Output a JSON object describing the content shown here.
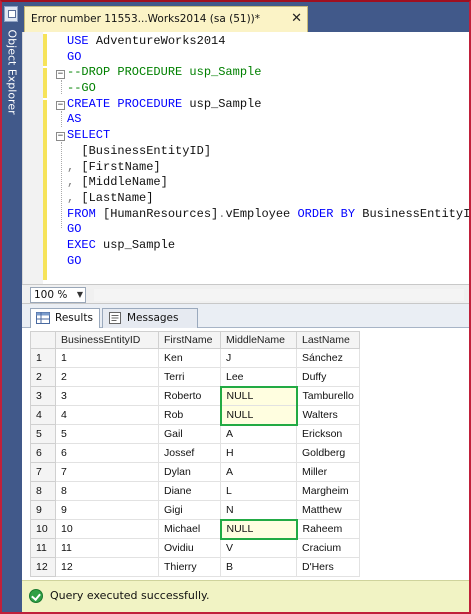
{
  "object_explorer": {
    "label": "Object Explorer"
  },
  "document_tab": {
    "title": "Error number 11553...Works2014 (sa (51))*",
    "close_glyph": "✕"
  },
  "editor": {
    "lines": [
      [
        {
          "t": "USE ",
          "c": "kw"
        },
        {
          "t": "AdventureWorks2014",
          "c": "tx"
        }
      ],
      [
        {
          "t": "GO",
          "c": "kw"
        }
      ],
      [
        {
          "t": "--DROP PROCEDURE usp_Sample",
          "c": "cm"
        }
      ],
      [
        {
          "t": "--GO",
          "c": "cm"
        }
      ],
      [
        {
          "t": "CREATE PROCEDURE ",
          "c": "kw"
        },
        {
          "t": "usp_Sample",
          "c": "tx"
        }
      ],
      [
        {
          "t": "AS",
          "c": "kw"
        }
      ],
      [
        {
          "t": "SELECT",
          "c": "kw"
        }
      ],
      [
        {
          "t": "  [BusinessEntityID]",
          "c": "tx"
        }
      ],
      [
        {
          "t": ", ",
          "c": "gy"
        },
        {
          "t": "[FirstName]",
          "c": "tx"
        }
      ],
      [
        {
          "t": ", ",
          "c": "gy"
        },
        {
          "t": "[MiddleName]",
          "c": "tx"
        }
      ],
      [
        {
          "t": ", ",
          "c": "gy"
        },
        {
          "t": "[LastName]",
          "c": "tx"
        }
      ],
      [
        {
          "t": "FROM ",
          "c": "kw"
        },
        {
          "t": "[HumanResources]",
          "c": "tx"
        },
        {
          "t": ".",
          "c": "gy"
        },
        {
          "t": "vEmployee ",
          "c": "tx"
        },
        {
          "t": "ORDER BY ",
          "c": "kw"
        },
        {
          "t": "BusinessEntityID",
          "c": "tx"
        }
      ],
      [
        {
          "t": "GO",
          "c": "kw"
        }
      ],
      [
        {
          "t": "EXEC ",
          "c": "kw"
        },
        {
          "t": "usp_Sample",
          "c": "tx"
        }
      ],
      [
        {
          "t": "GO",
          "c": "kw"
        }
      ]
    ]
  },
  "zoom": {
    "value": "100 %"
  },
  "results_tabs": {
    "results_label": "Results",
    "messages_label": "Messages"
  },
  "grid": {
    "columns": [
      "BusinessEntityID",
      "FirstName",
      "MiddleName",
      "LastName"
    ],
    "rows": [
      [
        "1",
        "1",
        "Ken",
        "J",
        "Sánchez"
      ],
      [
        "2",
        "2",
        "Terri",
        "Lee",
        "Duffy"
      ],
      [
        "3",
        "3",
        "Roberto",
        "NULL",
        "Tamburello"
      ],
      [
        "4",
        "4",
        "Rob",
        "NULL",
        "Walters"
      ],
      [
        "5",
        "5",
        "Gail",
        "A",
        "Erickson"
      ],
      [
        "6",
        "6",
        "Jossef",
        "H",
        "Goldberg"
      ],
      [
        "7",
        "7",
        "Dylan",
        "A",
        "Miller"
      ],
      [
        "8",
        "8",
        "Diane",
        "L",
        "Margheim"
      ],
      [
        "9",
        "9",
        "Gigi",
        "N",
        "Matthew"
      ],
      [
        "10",
        "10",
        "Michael",
        "NULL",
        "Raheem"
      ],
      [
        "11",
        "11",
        "Ovidiu",
        "V",
        "Cracium"
      ],
      [
        "12",
        "12",
        "Thierry",
        "B",
        "D'Hers"
      ]
    ]
  },
  "status": {
    "text": "Query executed successfully."
  },
  "colors": {
    "frame": "#c0203a",
    "highlight_box": "#22aa44",
    "keyword": "#0000ff",
    "comment": "#008000"
  }
}
